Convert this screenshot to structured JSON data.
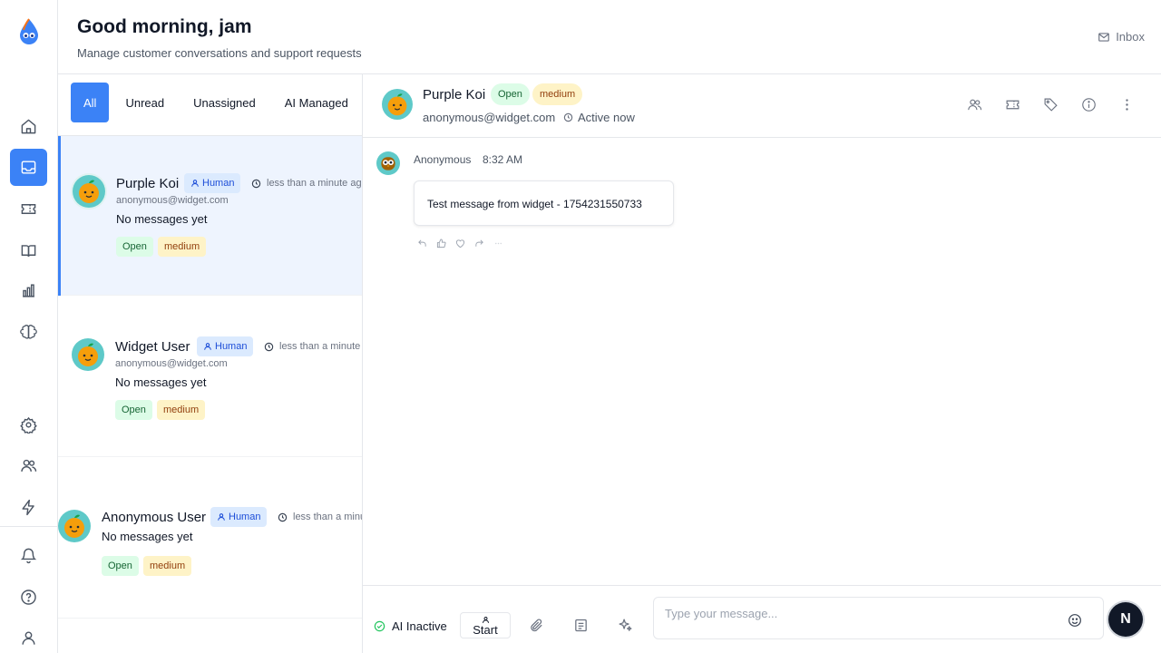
{
  "header": {
    "greeting": "Good morning, jam",
    "subtitle": "Manage customer conversations and support requests",
    "inbox_label": "Inbox"
  },
  "rail": {
    "items": [
      "home-icon",
      "inbox-icon",
      "ticket-icon",
      "book-icon",
      "chart-icon",
      "brain-icon"
    ],
    "bottom_items": [
      "settings-icon",
      "users-icon",
      "bolt-icon",
      "bell-icon",
      "help-icon",
      "user-icon"
    ],
    "active": "inbox-icon"
  },
  "filters": {
    "tabs": [
      "All",
      "Unread",
      "Unassigned",
      "AI Managed"
    ],
    "active": "All"
  },
  "conversations": [
    {
      "name": "Purple Koi",
      "badge": "Human",
      "time": "less than a minute ago",
      "email": "anonymous@widget.com",
      "preview": "No messages yet",
      "status": "Open",
      "priority": "medium",
      "selected": true
    },
    {
      "name": "Widget User",
      "badge": "Human",
      "time": "less than a minute ago",
      "email": "anonymous@widget.com",
      "preview": "No messages yet",
      "status": "Open",
      "priority": "medium",
      "selected": false
    },
    {
      "name": "Anonymous User",
      "badge": "Human",
      "time": "less than a minute ago",
      "email": "",
      "preview": "No messages yet",
      "status": "Open",
      "priority": "medium",
      "selected": false
    }
  ],
  "chat": {
    "contact_name": "Purple Koi",
    "status": "Open",
    "priority": "medium",
    "email": "anonymous@widget.com",
    "presence": "Active now",
    "header_actions": [
      "assign-icon",
      "ticket-icon",
      "tag-icon",
      "info-icon",
      "more-icon"
    ],
    "messages": [
      {
        "sender": "Anonymous",
        "time": "8:32 AM",
        "text": "Test message from widget - 1754231550733"
      }
    ],
    "reactions": [
      "reply-icon",
      "thumbs-up-icon",
      "heart-icon",
      "forward-icon",
      "more-icon"
    ]
  },
  "composer": {
    "ai_status": "AI Inactive",
    "start_label": "Start",
    "placeholder": "Type your message...",
    "send_avatar": "N"
  },
  "colors": {
    "accent": "#3b82f6",
    "open_bg": "#dcfce7",
    "open_fg": "#166534",
    "medium_bg": "#fef3c7",
    "medium_fg": "#92400e",
    "human_bg": "#dbeafe",
    "human_fg": "#1d4ed8"
  }
}
